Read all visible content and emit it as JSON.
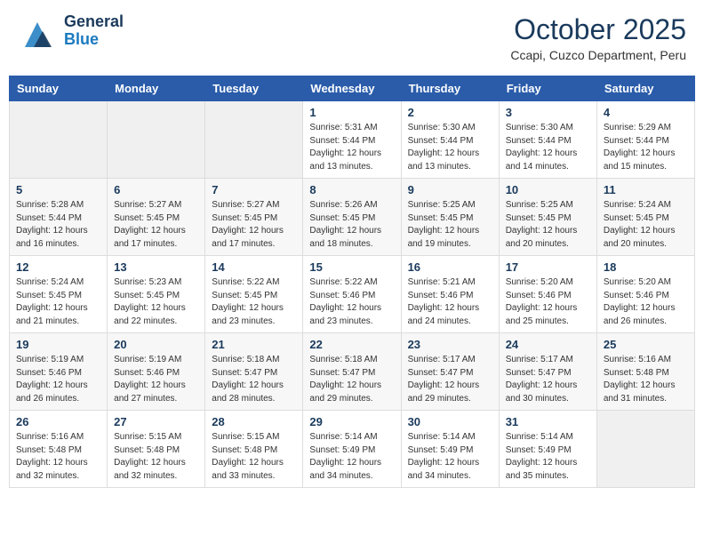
{
  "logo": {
    "general": "General",
    "blue": "Blue"
  },
  "header": {
    "month": "October 2025",
    "location": "Ccapi, Cuzco Department, Peru"
  },
  "weekdays": [
    "Sunday",
    "Monday",
    "Tuesday",
    "Wednesday",
    "Thursday",
    "Friday",
    "Saturday"
  ],
  "weeks": [
    [
      {
        "day": "",
        "info": ""
      },
      {
        "day": "",
        "info": ""
      },
      {
        "day": "",
        "info": ""
      },
      {
        "day": "1",
        "info": "Sunrise: 5:31 AM\nSunset: 5:44 PM\nDaylight: 12 hours and 13 minutes."
      },
      {
        "day": "2",
        "info": "Sunrise: 5:30 AM\nSunset: 5:44 PM\nDaylight: 12 hours and 13 minutes."
      },
      {
        "day": "3",
        "info": "Sunrise: 5:30 AM\nSunset: 5:44 PM\nDaylight: 12 hours and 14 minutes."
      },
      {
        "day": "4",
        "info": "Sunrise: 5:29 AM\nSunset: 5:44 PM\nDaylight: 12 hours and 15 minutes."
      }
    ],
    [
      {
        "day": "5",
        "info": "Sunrise: 5:28 AM\nSunset: 5:44 PM\nDaylight: 12 hours and 16 minutes."
      },
      {
        "day": "6",
        "info": "Sunrise: 5:27 AM\nSunset: 5:45 PM\nDaylight: 12 hours and 17 minutes."
      },
      {
        "day": "7",
        "info": "Sunrise: 5:27 AM\nSunset: 5:45 PM\nDaylight: 12 hours and 17 minutes."
      },
      {
        "day": "8",
        "info": "Sunrise: 5:26 AM\nSunset: 5:45 PM\nDaylight: 12 hours and 18 minutes."
      },
      {
        "day": "9",
        "info": "Sunrise: 5:25 AM\nSunset: 5:45 PM\nDaylight: 12 hours and 19 minutes."
      },
      {
        "day": "10",
        "info": "Sunrise: 5:25 AM\nSunset: 5:45 PM\nDaylight: 12 hours and 20 minutes."
      },
      {
        "day": "11",
        "info": "Sunrise: 5:24 AM\nSunset: 5:45 PM\nDaylight: 12 hours and 20 minutes."
      }
    ],
    [
      {
        "day": "12",
        "info": "Sunrise: 5:24 AM\nSunset: 5:45 PM\nDaylight: 12 hours and 21 minutes."
      },
      {
        "day": "13",
        "info": "Sunrise: 5:23 AM\nSunset: 5:45 PM\nDaylight: 12 hours and 22 minutes."
      },
      {
        "day": "14",
        "info": "Sunrise: 5:22 AM\nSunset: 5:45 PM\nDaylight: 12 hours and 23 minutes."
      },
      {
        "day": "15",
        "info": "Sunrise: 5:22 AM\nSunset: 5:46 PM\nDaylight: 12 hours and 23 minutes."
      },
      {
        "day": "16",
        "info": "Sunrise: 5:21 AM\nSunset: 5:46 PM\nDaylight: 12 hours and 24 minutes."
      },
      {
        "day": "17",
        "info": "Sunrise: 5:20 AM\nSunset: 5:46 PM\nDaylight: 12 hours and 25 minutes."
      },
      {
        "day": "18",
        "info": "Sunrise: 5:20 AM\nSunset: 5:46 PM\nDaylight: 12 hours and 26 minutes."
      }
    ],
    [
      {
        "day": "19",
        "info": "Sunrise: 5:19 AM\nSunset: 5:46 PM\nDaylight: 12 hours and 26 minutes."
      },
      {
        "day": "20",
        "info": "Sunrise: 5:19 AM\nSunset: 5:46 PM\nDaylight: 12 hours and 27 minutes."
      },
      {
        "day": "21",
        "info": "Sunrise: 5:18 AM\nSunset: 5:47 PM\nDaylight: 12 hours and 28 minutes."
      },
      {
        "day": "22",
        "info": "Sunrise: 5:18 AM\nSunset: 5:47 PM\nDaylight: 12 hours and 29 minutes."
      },
      {
        "day": "23",
        "info": "Sunrise: 5:17 AM\nSunset: 5:47 PM\nDaylight: 12 hours and 29 minutes."
      },
      {
        "day": "24",
        "info": "Sunrise: 5:17 AM\nSunset: 5:47 PM\nDaylight: 12 hours and 30 minutes."
      },
      {
        "day": "25",
        "info": "Sunrise: 5:16 AM\nSunset: 5:48 PM\nDaylight: 12 hours and 31 minutes."
      }
    ],
    [
      {
        "day": "26",
        "info": "Sunrise: 5:16 AM\nSunset: 5:48 PM\nDaylight: 12 hours and 32 minutes."
      },
      {
        "day": "27",
        "info": "Sunrise: 5:15 AM\nSunset: 5:48 PM\nDaylight: 12 hours and 32 minutes."
      },
      {
        "day": "28",
        "info": "Sunrise: 5:15 AM\nSunset: 5:48 PM\nDaylight: 12 hours and 33 minutes."
      },
      {
        "day": "29",
        "info": "Sunrise: 5:14 AM\nSunset: 5:49 PM\nDaylight: 12 hours and 34 minutes."
      },
      {
        "day": "30",
        "info": "Sunrise: 5:14 AM\nSunset: 5:49 PM\nDaylight: 12 hours and 34 minutes."
      },
      {
        "day": "31",
        "info": "Sunrise: 5:14 AM\nSunset: 5:49 PM\nDaylight: 12 hours and 35 minutes."
      },
      {
        "day": "",
        "info": ""
      }
    ]
  ]
}
